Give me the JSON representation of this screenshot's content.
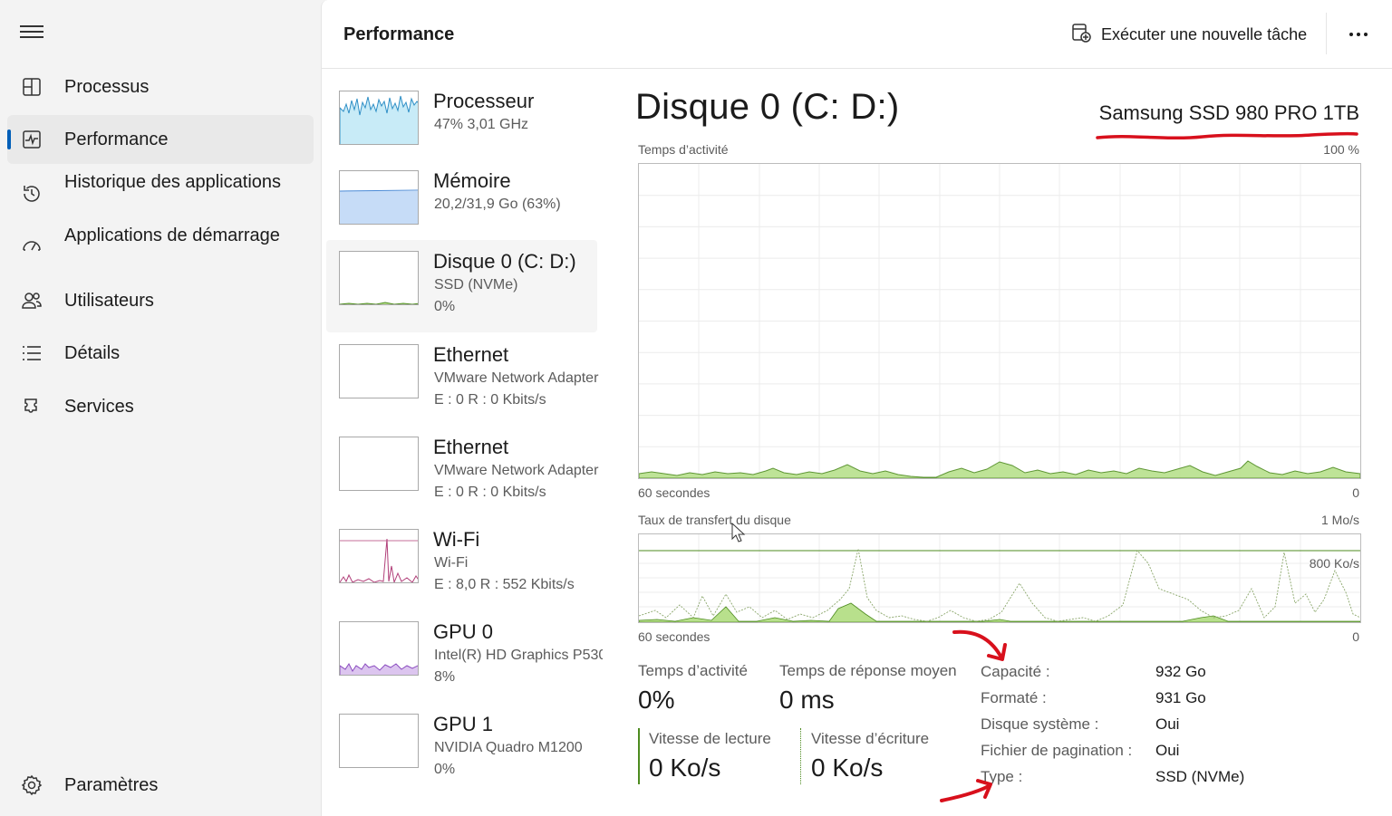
{
  "nav": {
    "items": [
      {
        "label": "Processus",
        "icon": "processes-icon"
      },
      {
        "label": "Performance",
        "icon": "performance-icon"
      },
      {
        "label": "Historique des applications",
        "icon": "history-icon"
      },
      {
        "label": "Applications de démarrage",
        "icon": "startup-icon"
      },
      {
        "label": "Utilisateurs",
        "icon": "users-icon"
      },
      {
        "label": "Détails",
        "icon": "details-list-icon"
      },
      {
        "label": "Services",
        "icon": "services-icon"
      }
    ],
    "settings_label": "Paramètres"
  },
  "header": {
    "title": "Performance",
    "run_task_label": "Exécuter une nouvelle tâche"
  },
  "resources": [
    {
      "name": "Processeur",
      "line1": "47%  3,01 GHz",
      "line2": ""
    },
    {
      "name": "Mémoire",
      "line1": "20,2/31,9 Go (63%)",
      "line2": ""
    },
    {
      "name": "Disque 0 (C: D:)",
      "line1": "SSD (NVMe)",
      "line2": "0%"
    },
    {
      "name": "Ethernet",
      "line1": "VMware Network Adapter",
      "line2": "E : 0  R : 0 Kbits/s"
    },
    {
      "name": "Ethernet",
      "line1": "VMware Network Adapter",
      "line2": "E : 0  R : 0 Kbits/s"
    },
    {
      "name": "Wi-Fi",
      "line1": "Wi-Fi",
      "line2": "E : 8,0  R : 552 Kbits/s"
    },
    {
      "name": "GPU 0",
      "line1": "Intel(R) HD Graphics P530",
      "line2": "8%"
    },
    {
      "name": "GPU 1",
      "line1": "NVIDIA Quadro M1200",
      "line2": "0%"
    }
  ],
  "detail": {
    "title": "Disque 0 (C: D:)",
    "model": "Samsung SSD 980 PRO 1TB",
    "activity_chart": {
      "label": "Temps d’activité",
      "max": "100 %",
      "x_left": "60 secondes",
      "x_right": "0"
    },
    "transfer_chart": {
      "label": "Taux de transfert du disque",
      "max": "1 Mo/s",
      "ref_line": "800 Ko/s",
      "x_left": "60 secondes",
      "x_right": "0"
    },
    "stats": {
      "activity_label": "Temps d’activité",
      "activity_value": "0%",
      "response_label": "Temps de réponse moyen",
      "response_value": "0 ms",
      "read_label": "Vitesse de lecture",
      "read_value": "0 Ko/s",
      "write_label": "Vitesse d’écriture",
      "write_value": "0 Ko/s"
    },
    "properties": [
      {
        "label": "Capacité :",
        "value": "932 Go"
      },
      {
        "label": "Formaté :",
        "value": "931 Go"
      },
      {
        "label": "Disque système :",
        "value": "Oui"
      },
      {
        "label": "Fichier de pagination :",
        "value": "Oui"
      },
      {
        "label": "Type :",
        "value": "SSD (NVMe)"
      }
    ]
  },
  "colors": {
    "accent": "#005fb8",
    "disk_green": "#4d8b1f",
    "disk_fill": "#b8e08c",
    "cpu_line": "#2f8fc6",
    "cpu_fill": "#c8ebf7",
    "mem_fill": "#c6dcf7",
    "wifi_line": "#b13f79",
    "gpu_fill": "#dcc5ef",
    "annotation_red": "#d8101c"
  }
}
